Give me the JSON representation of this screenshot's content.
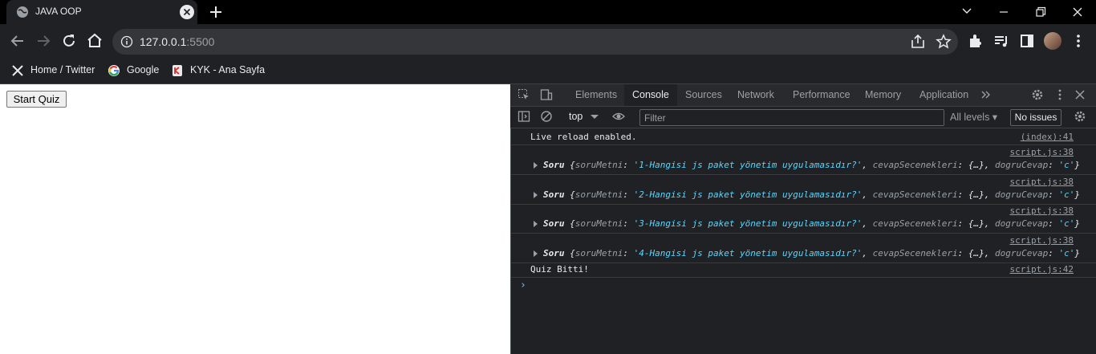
{
  "browser": {
    "tab_title": "JAVA OOP",
    "url_host": "127.0.0.1",
    "url_port": ":5500",
    "bookmarks": [
      {
        "label": "Home / Twitter",
        "icon": "x-logo-icon"
      },
      {
        "label": "Google",
        "icon": "google-icon"
      },
      {
        "label": "KYK - Ana Sayfa",
        "icon": "kyk-icon"
      }
    ]
  },
  "page": {
    "start_button": "Start Quiz"
  },
  "devtools": {
    "tabs": [
      "Elements",
      "Console",
      "Sources",
      "Network",
      "Performance",
      "Memory",
      "Application"
    ],
    "active_tab": "Console",
    "context": "top",
    "filter_placeholder": "Filter",
    "levels": "All levels",
    "issues": "No issues",
    "logs": [
      {
        "text": "Live reload enabled.",
        "source": "(index):41"
      },
      {
        "class": "Soru",
        "text": "1-Hangisi js paket yönetim uygulamasıdır?",
        "source": "script.js:38"
      },
      {
        "class": "Soru",
        "text": "2-Hangisi js paket yönetim uygulamasıdır?",
        "source": "script.js:38"
      },
      {
        "class": "Soru",
        "text": "3-Hangisi js paket yönetim uygulamasıdır?",
        "source": "script.js:38"
      },
      {
        "class": "Soru",
        "text": "4-Hangisi js paket yönetim uygulamasıdır?",
        "source": "script.js:38"
      },
      {
        "text": "Quiz Bitti!",
        "source": "script.js:42"
      }
    ],
    "obj_keys": {
      "k1": "soruMetni",
      "k2": "cevapSecenekleri",
      "k2val": "{…}",
      "k3": "dogruCevap",
      "k3val": "'c'"
    }
  }
}
